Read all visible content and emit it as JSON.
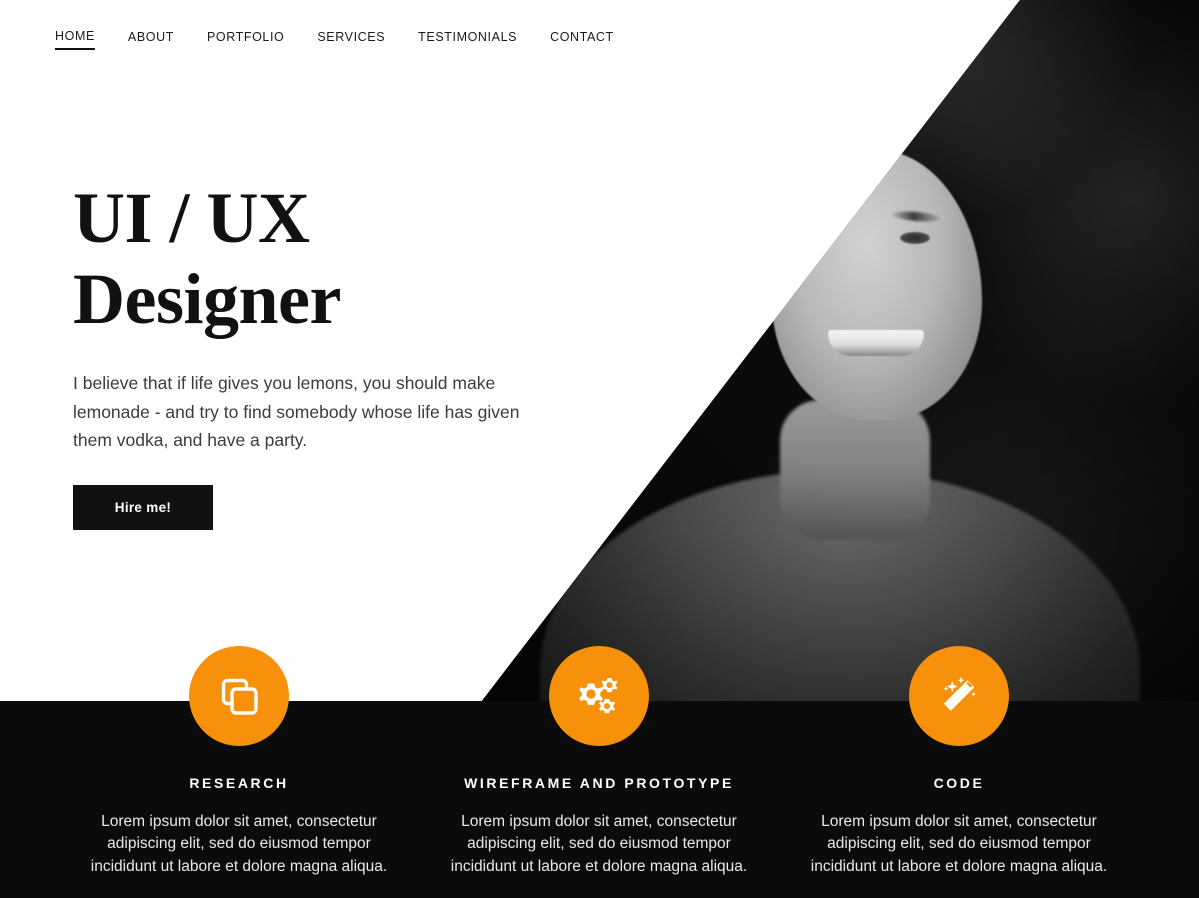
{
  "theme": {
    "accent": "#F7910B",
    "dark": "#0b0b0b",
    "light": "#ffffff",
    "text": "#111111"
  },
  "nav": {
    "items": [
      {
        "label": "HOME",
        "active": true
      },
      {
        "label": "ABOUT",
        "active": false
      },
      {
        "label": "PORTFOLIO",
        "active": false
      },
      {
        "label": "SERVICES",
        "active": false
      },
      {
        "label": "TESTIMONIALS",
        "active": false
      },
      {
        "label": "CONTACT",
        "active": false
      }
    ]
  },
  "hero": {
    "title_line1": "UI / UX",
    "title_line2": "Designer",
    "description": "I believe that if life gives you lemons, you should make lemonade - and try to find somebody whose life has given them vodka, and have a party.",
    "cta_label": "Hire me!",
    "photo_alt": "Portrait of smiling young man, black and white"
  },
  "features": [
    {
      "icon": "clone-icon",
      "title": "RESEARCH",
      "description": "Lorem ipsum dolor sit amet, consectetur adipiscing elit, sed do eiusmod tempor incididunt ut labore et dolore magna aliqua."
    },
    {
      "icon": "gears-icon",
      "title": "WIREFRAME AND PROTOTYPE",
      "description": "Lorem ipsum dolor sit amet, consectetur adipiscing elit, sed do eiusmod tempor incididunt ut labore et dolore magna aliqua."
    },
    {
      "icon": "magic-wand-icon",
      "title": "CODE",
      "description": "Lorem ipsum dolor sit amet, consectetur adipiscing elit, sed do eiusmod tempor incididunt ut labore et dolore magna aliqua."
    }
  ]
}
